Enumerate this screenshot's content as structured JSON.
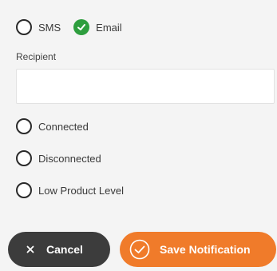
{
  "channel": {
    "sms_label": "SMS",
    "email_label": "Email",
    "selected": "Email"
  },
  "recipient": {
    "label": "Recipient",
    "value": "",
    "placeholder": ""
  },
  "events": [
    {
      "label": "Connected",
      "checked": false
    },
    {
      "label": "Disconnected",
      "checked": false
    },
    {
      "label": "Low Product Level",
      "checked": false
    }
  ],
  "actions": {
    "cancel_label": "Cancel",
    "save_label": "Save Notification"
  },
  "colors": {
    "selected_green": "#2e9e3e",
    "cancel_bg": "#3c3c3c",
    "save_bg": "#f07b2a"
  },
  "icons": {
    "cancel": "close-icon",
    "save": "check-circle-icon",
    "email_selected": "check-icon"
  }
}
